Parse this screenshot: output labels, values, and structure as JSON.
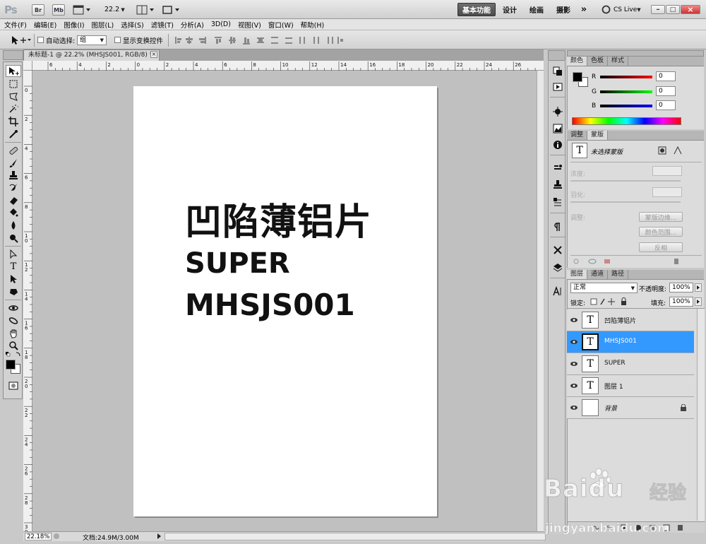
{
  "app": {
    "logo": "Ps",
    "br_label": "Br",
    "mb_label": "Mb",
    "zoom_value": "22.2",
    "workspaces": [
      "基本功能",
      "设计",
      "绘画",
      "摄影"
    ],
    "more": "»",
    "cslive": "CS Live",
    "win_min": "–",
    "win_max": "□",
    "win_close": "×"
  },
  "menu": [
    "文件(F)",
    "编辑(E)",
    "图像(I)",
    "图层(L)",
    "选择(S)",
    "滤镜(T)",
    "分析(A)",
    "3D(D)",
    "视图(V)",
    "窗口(W)",
    "帮助(H)"
  ],
  "options": {
    "auto_select_label": "自动选择:",
    "auto_select_value": "组",
    "transform_label": "显示变换控件"
  },
  "document": {
    "tab_title": "未标题-1 @ 22.2% (MHSJS001, RGB/8) *",
    "text_line1": "凹陷薄铝片",
    "text_line2": "SUPER",
    "text_line3": "MHSJS001",
    "hruler_labels": [
      "6",
      "4",
      "2",
      "0",
      "2",
      "4",
      "6",
      "8",
      "10",
      "12",
      "14",
      "16",
      "18",
      "20",
      "22",
      "24",
      "26"
    ],
    "vruler_labels": [
      "0",
      "2",
      "4",
      "6",
      "8",
      "1 0",
      "1 2",
      "1 4",
      "1 6",
      "1 8",
      "2 0",
      "2 2",
      "2 4",
      "2 6",
      "2 8",
      "3 0"
    ],
    "status_zoom": "22.18%",
    "status_doc": "文档:24.9M/3.00M"
  },
  "color_panel": {
    "tabs": [
      "颜色",
      "色板",
      "样式"
    ],
    "r_label": "R",
    "g_label": "G",
    "b_label": "B",
    "r_value": "0",
    "g_value": "0",
    "b_value": "0"
  },
  "masks_panel": {
    "tabs": [
      "调整",
      "蒙版"
    ],
    "no_selection": "未选择蒙版",
    "density": "浓度:",
    "feather": "羽化:",
    "refine": "调整:",
    "mask_edge": "蒙版边缘...",
    "color_range": "颜色范围...",
    "invert": "反相"
  },
  "layers_panel": {
    "tabs": [
      "图层",
      "通道",
      "路径"
    ],
    "blend_mode": "正常",
    "opacity_label": "不透明度:",
    "opacity_value": "100%",
    "lock_label": "锁定:",
    "fill_label": "填充:",
    "fill_value": "100%",
    "layers": [
      {
        "name": "凹陷薄铝片",
        "type": "text",
        "selected": false
      },
      {
        "name": "MHSJS001",
        "type": "text",
        "selected": true
      },
      {
        "name": "SUPER",
        "type": "text",
        "selected": false
      },
      {
        "name": "图层 1",
        "type": "text",
        "selected": false
      },
      {
        "name": "背景",
        "type": "background",
        "selected": false
      }
    ],
    "thumb_text_glyph": "T"
  },
  "watermark": {
    "brand": "Baidu",
    "chinese": "经验",
    "url": "jingyan.baidu.com"
  },
  "colors": {
    "selected_layer": "#3399ff",
    "foreground": "#000000",
    "background": "#ffffff"
  }
}
